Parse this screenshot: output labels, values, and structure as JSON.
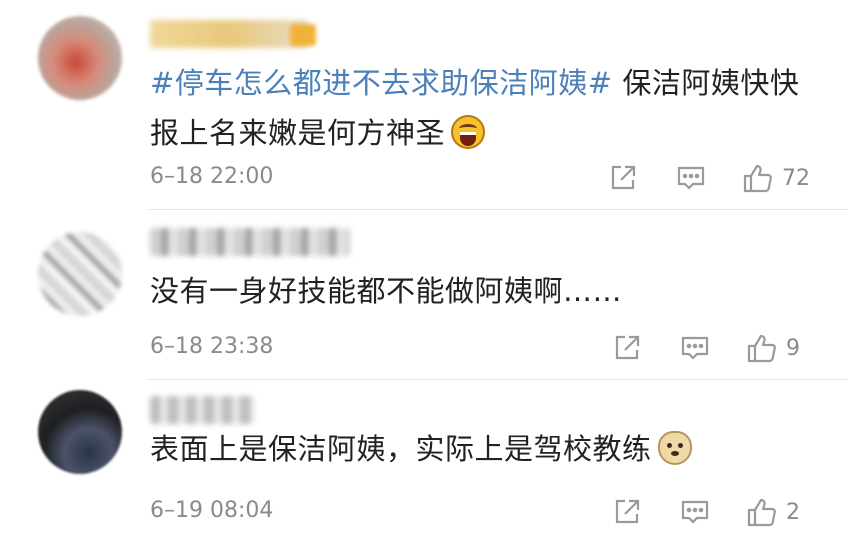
{
  "comments": [
    {
      "text_topic": "#停车怎么都进不去求助保洁阿姨#",
      "text_body": " 保洁阿姨快快报上名来嫩是何方神圣",
      "emoji": "laughing-emoji",
      "timestamp": "6–18 22:00",
      "likes": "72"
    },
    {
      "text_body": "没有一身好技能都不能做阿姨啊……",
      "timestamp": "6–18 23:38",
      "likes": "9"
    },
    {
      "text_body": "表面上是保洁阿姨，实际上是驾校教练",
      "emoji": "doge-emoji",
      "timestamp": "6–19 08:04",
      "likes": "2"
    }
  ],
  "colors": {
    "topic": "#4c80b8",
    "text": "#222222",
    "meta": "#8a8a8a",
    "icon": "#9a9a9a"
  },
  "icons": [
    "share-icon",
    "comment-icon",
    "like-icon"
  ]
}
